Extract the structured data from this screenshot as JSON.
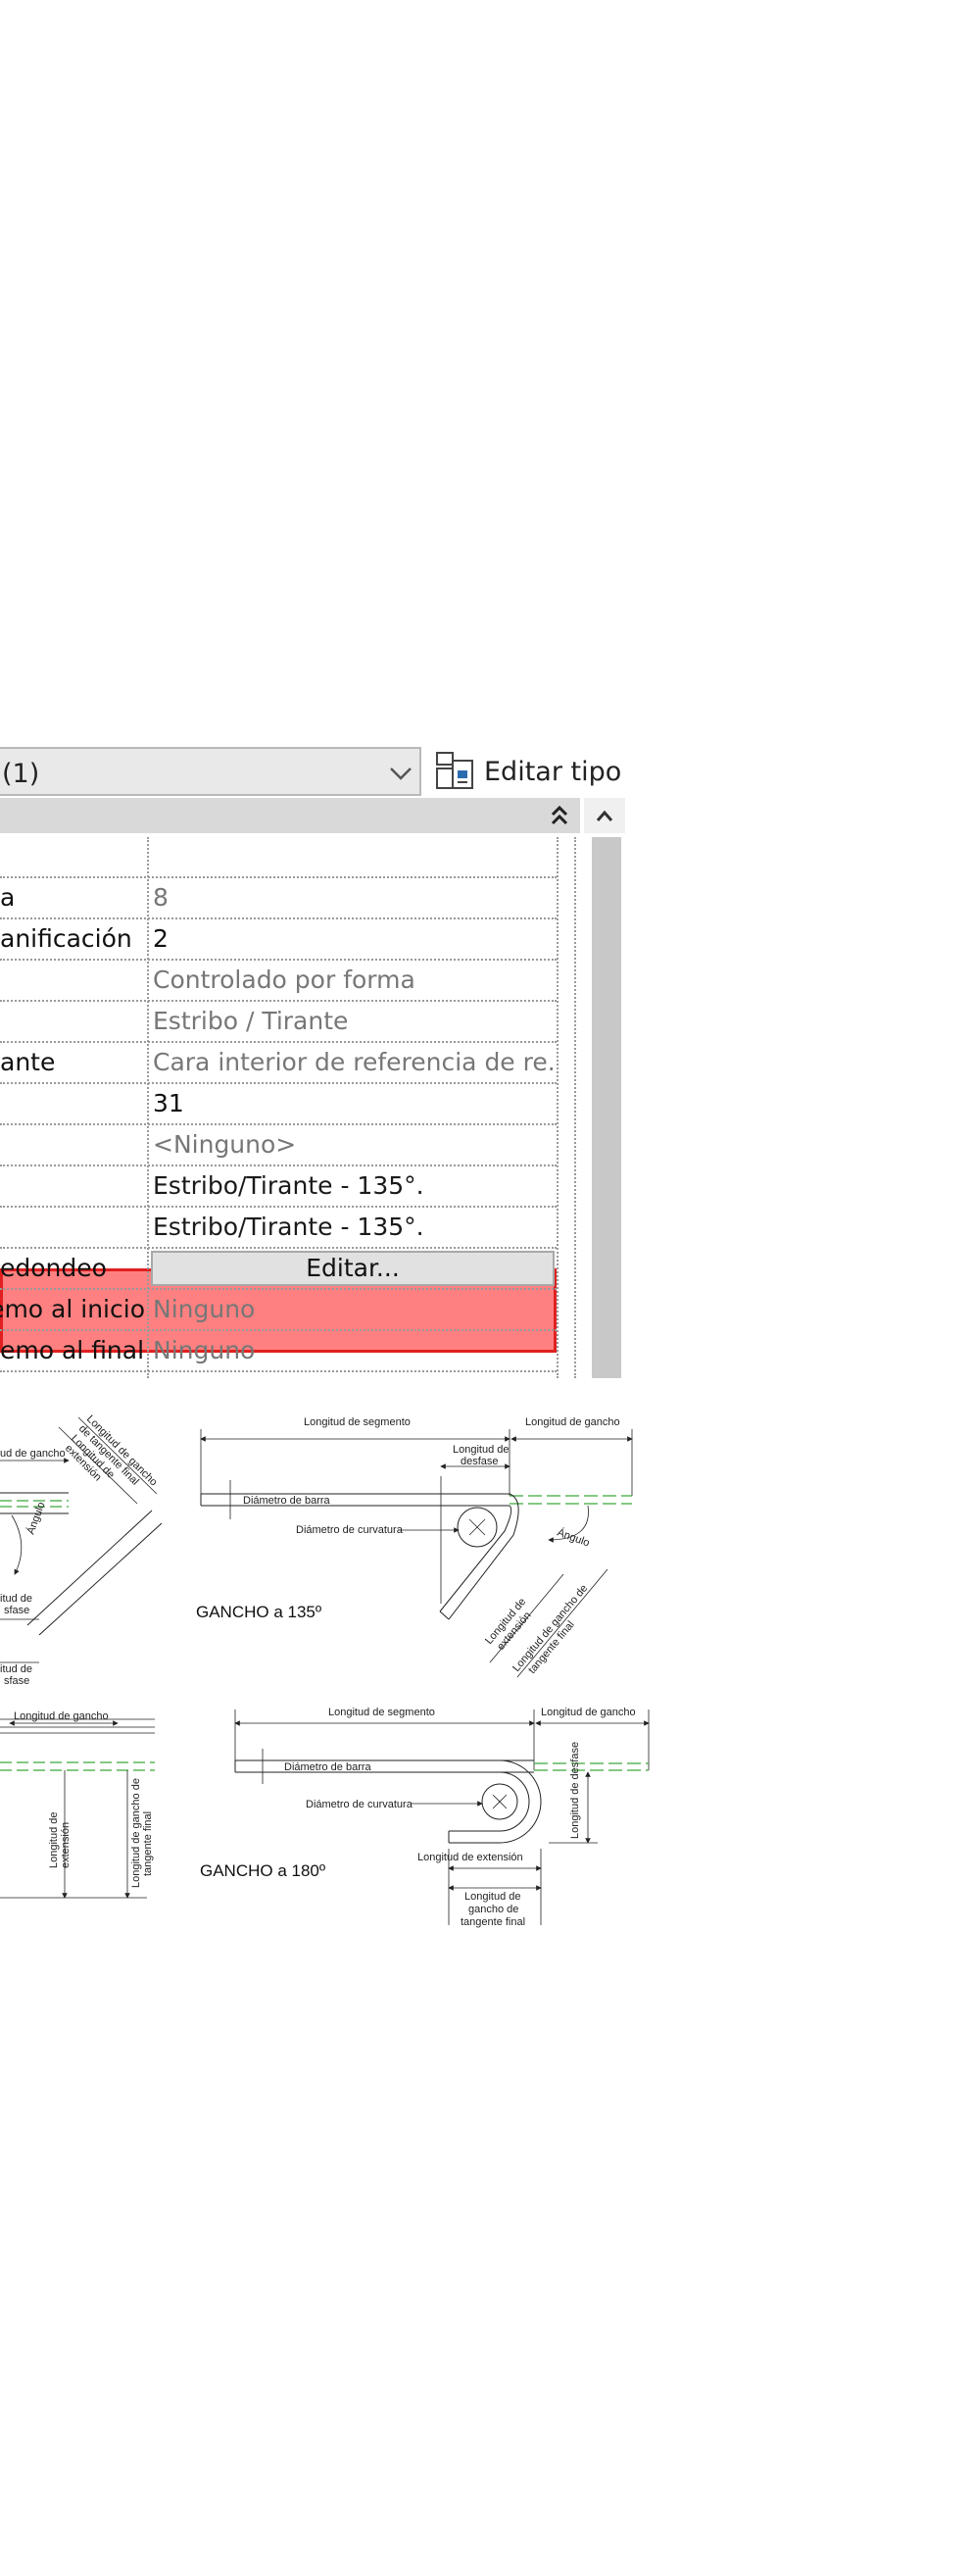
{
  "header": {
    "type_selector_text": "(1)",
    "edit_type_label": "Editar tipo"
  },
  "properties": {
    "rows": [
      {
        "name": "",
        "value": ""
      },
      {
        "name": "a",
        "value": "8"
      },
      {
        "name": "anificación",
        "value": "2"
      },
      {
        "name": "",
        "value": "Controlado por forma"
      },
      {
        "name": "",
        "value": "Estribo / Tirante"
      },
      {
        "name": "ante",
        "value": "Cara interior de referencia de re..."
      },
      {
        "name": "",
        "value": "31"
      },
      {
        "name": "",
        "value": "<Ninguno>"
      },
      {
        "name": "",
        "value": "Estribo/Tirante - 135°."
      },
      {
        "name": "",
        "value": "Estribo/Tirante - 135°."
      },
      {
        "name": "edondeo",
        "value": "Editar..."
      },
      {
        "name": "emo al inicio",
        "value": "Ninguno"
      },
      {
        "name": "emo al final",
        "value": "Ninguno"
      }
    ],
    "highlight_color": "#ff8080",
    "highlight_border": "#e02020"
  },
  "diagrams": {
    "hook135": {
      "caption": "GANCHO a 135º",
      "labels": {
        "segment_length": "Longitud de segmento",
        "hook_length": "Longitud de gancho",
        "offset_length_1": "Longitud de",
        "offset_length_2": "desfase",
        "bar_diameter": "Diámetro de barra",
        "bend_diameter": "Diámetro de curvatura",
        "angle": "Ángulo",
        "extension_1": "Longitud de",
        "extension_2": "extensión",
        "tangent_1": "Longitud de gancho de",
        "tangent_2": "tangente final"
      }
    },
    "hook180": {
      "caption": "GANCHO a 180º",
      "labels": {
        "segment_length": "Longitud de segmento",
        "hook_length": "Longitud de gancho",
        "bar_diameter": "Diámetro de barra",
        "bend_diameter": "Diámetro de curvatura",
        "offset_length": "Longitud de desfase",
        "extension_length": "Longitud de extensión",
        "tangent_1": "Longitud de",
        "tangent_2": "gancho de",
        "tangent_3": "tangente final"
      }
    },
    "partial_left_top": {
      "labels": {
        "hook_length": "ud de gancho",
        "tangent_a": "Longitud de gancho",
        "tangent_b": "de tangente final",
        "tangent_c": "Longitud de",
        "tangent_d": "extensión",
        "angle": "Ángulo",
        "off_a": "itud de",
        "off_b": "sfase",
        "off_c": "itud de",
        "off_d": "sfase"
      }
    },
    "partial_left_bottom": {
      "labels": {
        "hook_length": "Longitud de gancho",
        "extension_a": "Longitud de",
        "extension_b": "extensión",
        "tangent_a": "Longitud de gancho de",
        "tangent_b": "tangente final"
      }
    }
  }
}
